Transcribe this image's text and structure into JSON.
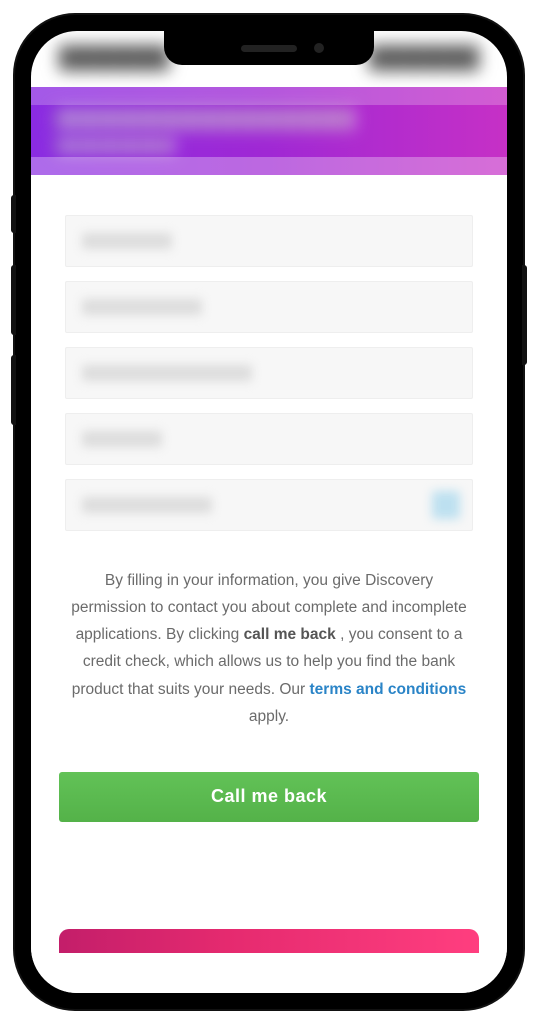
{
  "status": {
    "left": "███",
    "right": "███"
  },
  "header": {
    "title": "████████████",
    "subtitle": "██████"
  },
  "form": {
    "fields": [
      {
        "placeholder": "█████"
      },
      {
        "placeholder": "███████"
      },
      {
        "placeholder": "██████████"
      },
      {
        "placeholder": "█████"
      },
      {
        "placeholder": "████████",
        "has_icon": true
      }
    ]
  },
  "consent": {
    "part1": "By filling in your information, you give Discovery permission to contact you about complete and incomplete applications. By clicking ",
    "bold": "call me back",
    "part2": ", you consent to a credit check, which allows us to help you find the bank product that suits your needs. Our ",
    "link_label": "terms and conditions",
    "part3": " apply."
  },
  "cta": {
    "label": "Call me back"
  },
  "colors": {
    "header_gradient_start": "#8a2be2",
    "header_gradient_end": "#c630c6",
    "cta_bg": "#5bbb4f",
    "link": "#2a84c7",
    "bottom_bar_start": "#c31e6a",
    "bottom_bar_end": "#ff3e7f"
  }
}
